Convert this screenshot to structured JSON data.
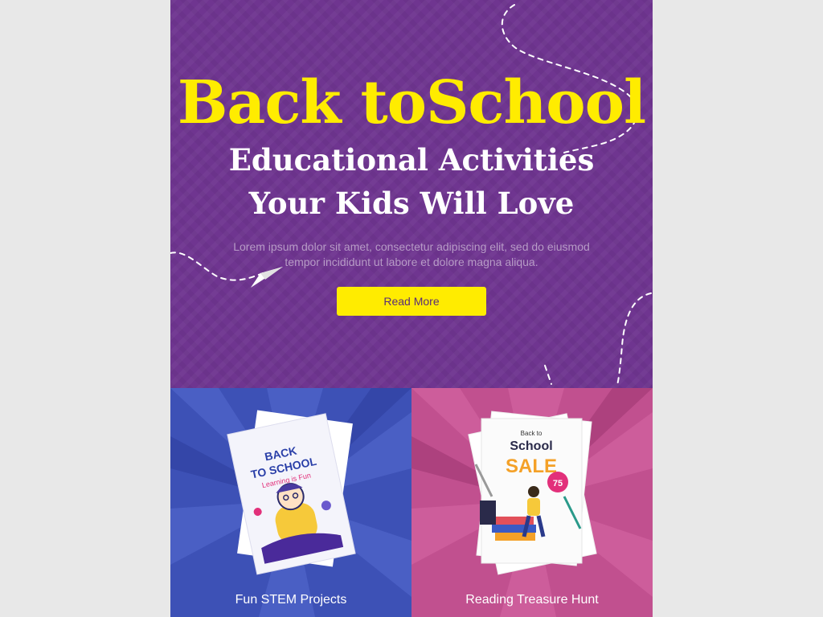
{
  "hero": {
    "title": "Back toSchool",
    "subtitle": "Educational Activities Your Kids Will Love",
    "body": "Lorem ipsum dolor sit amet, consectetur adipiscing elit, sed do eiusmod tempor incididunt ut labore et dolore magna aliqua.",
    "button_label": "Read More",
    "colors": {
      "background": "#6f3590",
      "title": "#ffec00",
      "button": "#ffec00"
    }
  },
  "cards": [
    {
      "label": "Fun STEM Projects",
      "color": "#3d51b6",
      "flyer": {
        "heading_line1": "BACK",
        "heading_line2": "TO SCHOOL",
        "tagline": "Learning is Fun"
      }
    },
    {
      "label": "Reading Treasure Hunt",
      "color": "#c1508f",
      "flyer": {
        "heading_small": "Back to",
        "heading_line1": "School",
        "heading_line2": "SALE",
        "badge": "75"
      }
    }
  ],
  "icons": [
    "paper-plane-icon",
    "dashed-trail-icon"
  ]
}
